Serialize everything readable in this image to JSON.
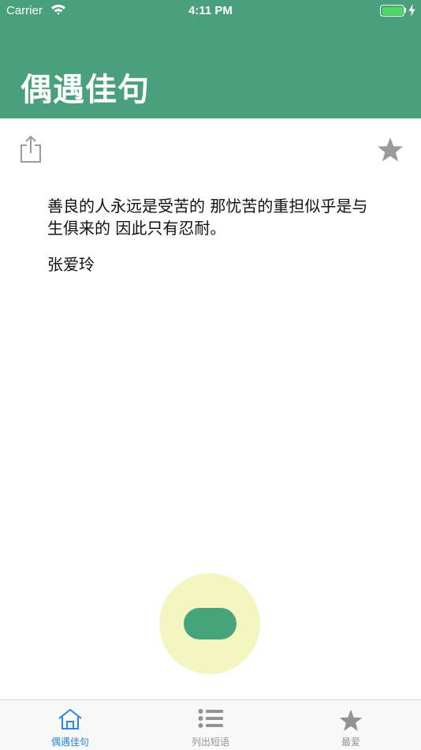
{
  "status_bar": {
    "carrier": "Carrier",
    "time": "4:11 PM",
    "battery_level": 1.0
  },
  "header": {
    "title": "偶遇佳句",
    "background_color": "#49a07a"
  },
  "toolbar": {
    "share_icon": "share-icon",
    "favorite_icon": "star-icon"
  },
  "quote": {
    "text": "善良的人永远是受苦的 那忧苦的重担似乎是与生俱来的 因此只有忍耐。",
    "author": "张爱玲"
  },
  "fab": {
    "outer_color": "#f4f6c1",
    "inner_color": "#46a47a"
  },
  "tabs": [
    {
      "label": "偶遇佳句",
      "icon": "home-icon",
      "active": true
    },
    {
      "label": "列出短语",
      "icon": "list-icon",
      "active": false
    },
    {
      "label": "最爱",
      "icon": "star-icon",
      "active": false
    }
  ],
  "colors": {
    "active_tab": "#2a86e1",
    "inactive_tab": "#929292"
  }
}
